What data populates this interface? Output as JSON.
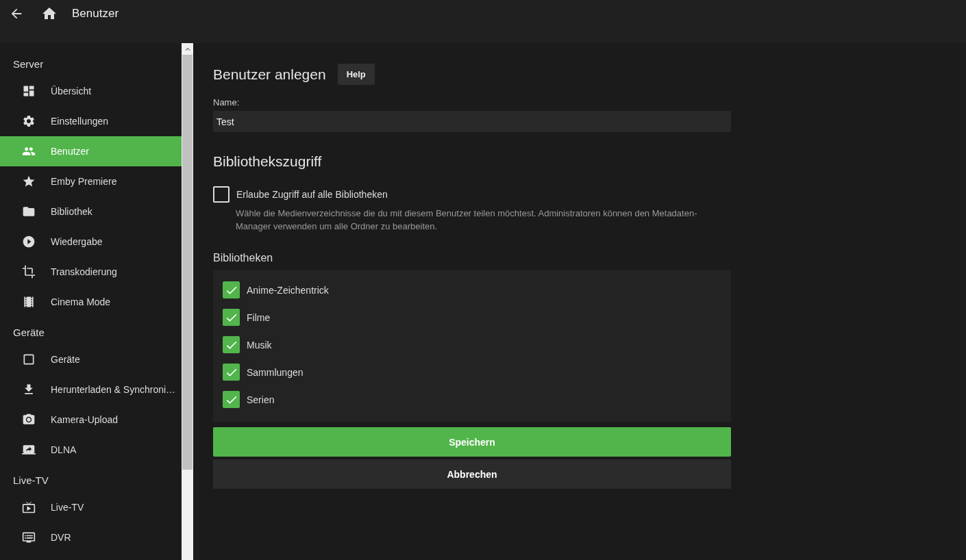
{
  "header": {
    "title": "Benutzer"
  },
  "sidebar": {
    "sections": [
      {
        "title": "Server",
        "items": [
          {
            "label": "Übersicht",
            "selected": false
          },
          {
            "label": "Einstellungen",
            "selected": false
          },
          {
            "label": "Benutzer",
            "selected": true
          },
          {
            "label": "Emby Premiere",
            "selected": false
          },
          {
            "label": "Bibliothek",
            "selected": false
          },
          {
            "label": "Wiedergabe",
            "selected": false
          },
          {
            "label": "Transkodierung",
            "selected": false
          },
          {
            "label": "Cinema Mode",
            "selected": false
          }
        ]
      },
      {
        "title": "Geräte",
        "items": [
          {
            "label": "Geräte",
            "selected": false
          },
          {
            "label": "Herunterladen & Synchroni…",
            "selected": false
          },
          {
            "label": "Kamera-Upload",
            "selected": false
          },
          {
            "label": "DLNA",
            "selected": false
          }
        ]
      },
      {
        "title": "Live-TV",
        "items": [
          {
            "label": "Live-TV",
            "selected": false
          },
          {
            "label": "DVR",
            "selected": false
          }
        ]
      }
    ]
  },
  "form": {
    "title": "Benutzer anlegen",
    "help_button": "Help",
    "name_label": "Name:",
    "name_value": "Test",
    "access_title": "Bibliothekszugriff",
    "allow_all": {
      "label": "Erlaube Zugriff auf alle Bibliotheken",
      "checked": false
    },
    "description": "Wähle die Medienverzeichnisse die du mit diesem Benutzer teilen möchtest. Administratoren können den Metadaten-Manager verwenden um alle Ordner zu bearbeiten.",
    "libraries_title": "Bibliotheken",
    "libraries": [
      {
        "label": "Anime-Zeichentrick",
        "checked": true
      },
      {
        "label": "Filme",
        "checked": true
      },
      {
        "label": "Musik",
        "checked": true
      },
      {
        "label": "Sammlungen",
        "checked": true
      },
      {
        "label": "Serien",
        "checked": true
      }
    ],
    "buttons": [
      {
        "label": "Speichern",
        "kind": "primary"
      },
      {
        "label": "Abbrechen",
        "kind": "secondary"
      }
    ]
  }
}
